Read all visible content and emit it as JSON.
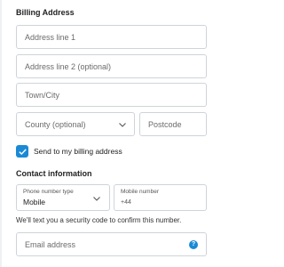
{
  "billing": {
    "title": "Billing Address",
    "address_line_1_placeholder": "Address line 1",
    "address_line_2_placeholder": "Address line 2 (optional)",
    "town_placeholder": "Town/City",
    "county_placeholder": "County (optional)",
    "postcode_placeholder": "Postcode"
  },
  "send_to_billing": {
    "label": "Send to my billing address",
    "checked": true
  },
  "contact": {
    "title": "Contact information",
    "phone_type_label": "Phone number type",
    "phone_type_value": "Mobile",
    "mobile_number_label": "Mobile number",
    "mobile_number_prefix": "+44",
    "helper_text": "We'll text you a security code to confirm this number.",
    "email_placeholder": "Email address"
  },
  "colors": {
    "accent": "#1a8ad6",
    "border": "#cfd4da"
  },
  "icons": {
    "checkbox": "check-icon",
    "dropdown": "chevron-down-icon",
    "help": "help-icon"
  }
}
